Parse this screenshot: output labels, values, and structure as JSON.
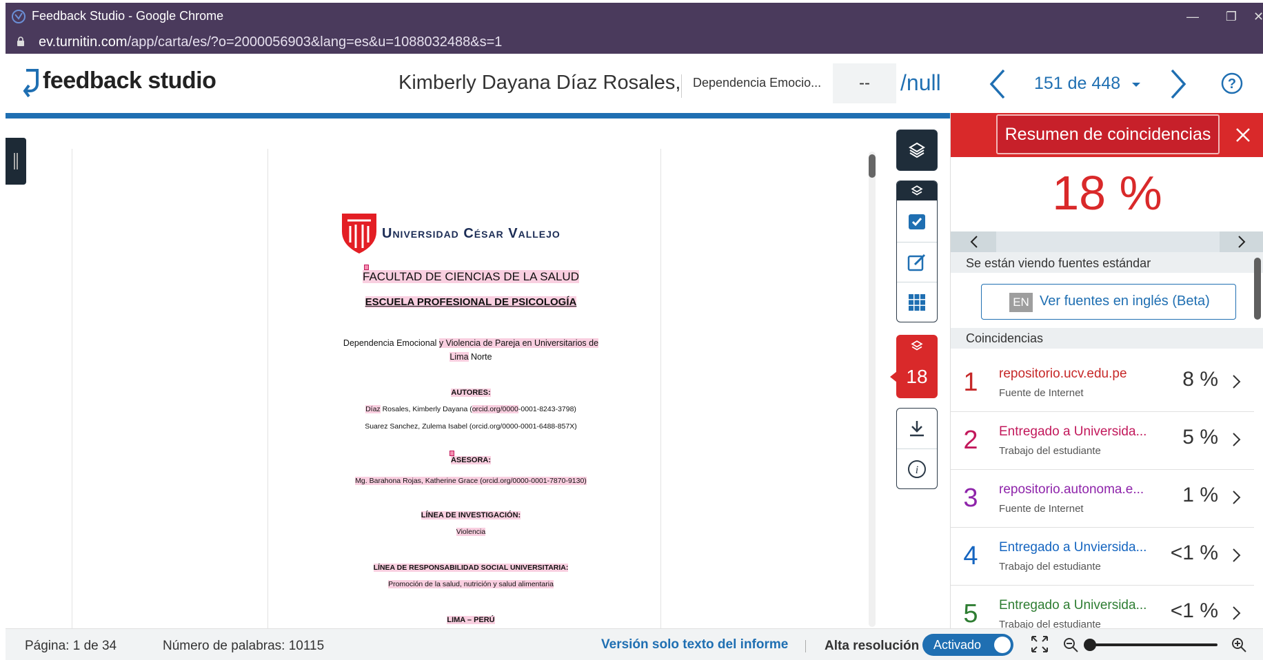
{
  "browser": {
    "window_title": "Feedback Studio - Google Chrome",
    "url_host": "ev.turnitin.com",
    "url_path": "/app/carta/es/?o=2000056903&lang=es&u=1088032488&s=1",
    "minimize": "—",
    "restore": "❐",
    "close": "✕"
  },
  "header": {
    "logo_text": "feedback studio",
    "student_name": "Kimberly Dayana Díaz Rosales,",
    "paper_title": "Dependencia Emocio...",
    "grade": "--",
    "grade_max": "/null",
    "paper_index": "151 de 448",
    "accent": "#1f6fb2"
  },
  "document": {
    "university": "Universidad César Vallejo",
    "faculty": "FACULTAD DE CIENCIAS DE LA SALUD",
    "school": "ESCUELA PROFESIONAL DE PSICOLOGÍA",
    "title_a": "Dependencia Emocional ",
    "title_b": "y Violencia de Pareja en Universitarios de",
    "title_c": "Lima",
    "title_d": " Norte",
    "authors_heading": "AUTORES:",
    "author1_a": "Díaz",
    "author1_b": " Rosales, Kimberly Dayana (",
    "author1_c": "orcid.org/0000",
    "author1_d": "-0001-8243-3798)",
    "author2": "Suarez Sanchez, Zulema Isabel (orcid.org/0000-0001-6488-857X)",
    "advisor_heading": "ASESORA:",
    "advisor": "Mg. Barahona Rojas, Katherine Grace (orcid.org/0000-0001-7870-9130)",
    "research_heading": "LÍNEA DE INVESTIGACIÓN:",
    "research": "Violencia",
    "social_heading": "LÍNEA DE RESPONSABILIDAD SOCIAL UNIVERSITARIA:",
    "social": "Promoción de la salud, nutrición y salud alimentaria",
    "location": "LIMA – PERÚ"
  },
  "toolbar": {
    "match_count": "18"
  },
  "panel": {
    "title": "Resumen de coincidencias",
    "score": "18 %",
    "viewing_note": "Se están viendo fuentes estándar",
    "en_badge": "EN",
    "en_button": "Ver fuentes en inglés (Beta)",
    "matches_heading": "Coincidencias",
    "matches": [
      {
        "num": "1",
        "name": "repositorio.ucv.edu.pe",
        "type": "Fuente de Internet",
        "pct": "8 %",
        "color": "#c62828"
      },
      {
        "num": "2",
        "name": "Entregado a Universida...",
        "type": "Trabajo del estudiante",
        "pct": "5 %",
        "color": "#c2185b"
      },
      {
        "num": "3",
        "name": "repositorio.autonoma.e...",
        "type": "Fuente de Internet",
        "pct": "1 %",
        "color": "#8e24aa"
      },
      {
        "num": "4",
        "name": "Entregado a Unviersida...",
        "type": "Trabajo del estudiante",
        "pct": "<1 %",
        "color": "#1565c0"
      },
      {
        "num": "5",
        "name": "Entregado a Universida...",
        "type": "Trabajo del estudiante",
        "pct": "<1 %",
        "color": "#2e7d32"
      }
    ]
  },
  "footer": {
    "page": "Página: 1 de 34",
    "words": "Número de palabras: 10115",
    "text_only": "Versión solo texto del informe",
    "separator": "|",
    "high_res": "Alta resolución",
    "toggle": "Activado"
  }
}
